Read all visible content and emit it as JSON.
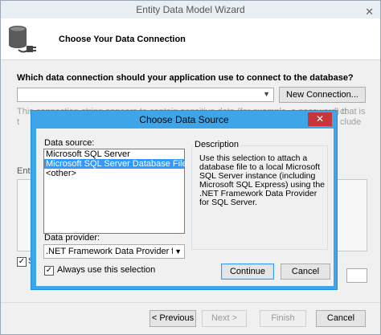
{
  "wizard": {
    "title": "Entity Data Model Wizard",
    "close_glyph": "✕",
    "heading": "Choose Your Data Connection",
    "question": "Which data connection should your application use to connect to the database?",
    "new_connection_label": "New Connection...",
    "faded_line1": "This connection string appears to contain sensitive data (for example, a password) that is required to connect",
    "faded_line2": "t",
    "faded_right1": "ct",
    "faded_right2": "clude",
    "faded_right3": "",
    "entity_label": "Enti",
    "save_check": "✓",
    "save_label": "S",
    "buttons": {
      "previous": "< Previous",
      "next": "Next >",
      "finish": "Finish",
      "cancel": "Cancel"
    }
  },
  "dialog": {
    "title": "Choose Data Source",
    "close_glyph": "✕",
    "data_source_label": "Data source:",
    "data_sources": [
      "Microsoft SQL Server",
      "Microsoft SQL Server Database File",
      "<other>"
    ],
    "selected_index": 1,
    "description_title": "Description",
    "description_text": "Use this selection to attach a database file to a local Microsoft SQL Server instance (including Microsoft SQL Express) using the .NET Framework Data Provider for SQL Server.",
    "data_provider_label": "Data provider:",
    "data_provider_value": ".NET Framework Data Provider for SQL S",
    "always_use_check": "✓",
    "always_use_label": "Always use this selection",
    "continue_label": "Continue",
    "cancel_label": "Cancel"
  },
  "colors": {
    "dialog_border": "#3ea6e8",
    "close_button": "#c7343a",
    "selection": "#3399ff"
  }
}
